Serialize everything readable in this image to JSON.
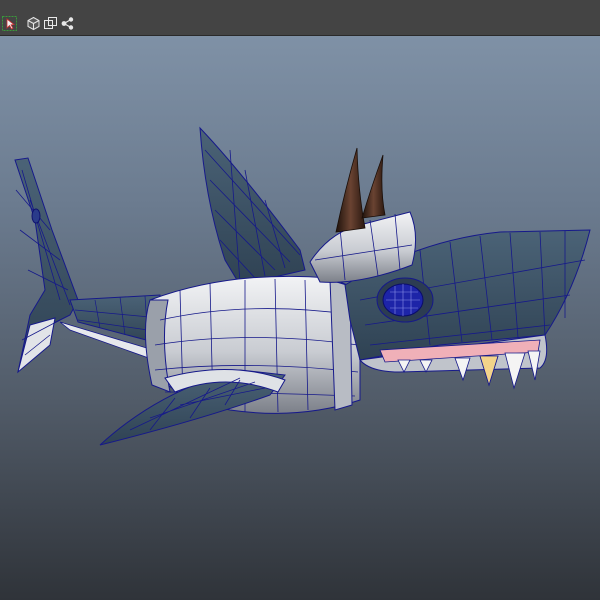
{
  "toolbar": {
    "buttons": [
      {
        "icon": "select-tool-icon"
      },
      {
        "icon": "cube-icon"
      },
      {
        "icon": "duplicate-icon"
      },
      {
        "icon": "node-graph-icon"
      }
    ]
  },
  "colors": {
    "toolbar_bg": "#444444",
    "viewport_top": "#7f91a6",
    "viewport_bottom": "#2f3339",
    "wireframe": "#1a1f8a",
    "body_dark": "#3b5266",
    "body_light": "#e6e8ec",
    "horn": "#3a2418"
  }
}
